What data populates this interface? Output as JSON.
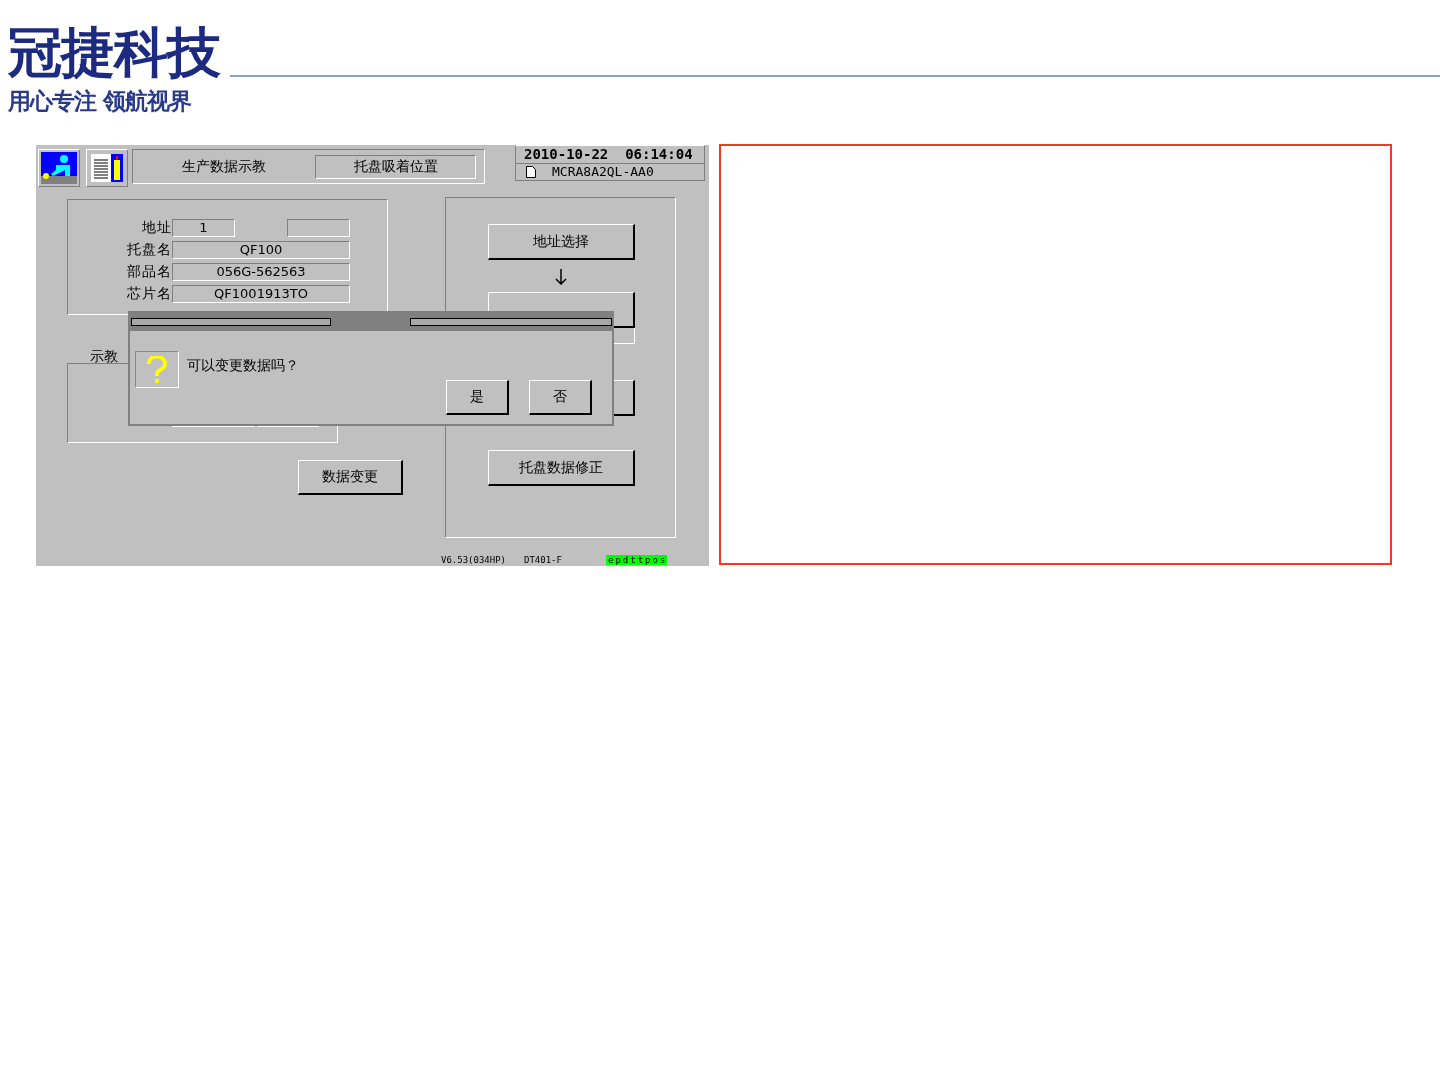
{
  "logo": {
    "name": "冠捷科技",
    "slogan": "用心专注 领航视界"
  },
  "screen": {
    "title": "生产数据示教",
    "subtitle": "托盘吸着位置",
    "datetime": "2010-10-22  06:14:04",
    "file": "MCRA8A2QL-AA0",
    "fields": [
      {
        "label": "地址",
        "value": "1",
        "extra_field": true
      },
      {
        "label": "托盘名",
        "value": "QF100",
        "extra_field": false
      },
      {
        "label": "部品名",
        "value": "056G-562563",
        "extra_field": false
      },
      {
        "label": "芯片名",
        "value": "QF1001913TO",
        "extra_field": false
      }
    ],
    "teach_label": "示教",
    "change_button": "数据变更",
    "right_buttons": [
      "地址选择",
      "托盘数据修正"
    ],
    "status": {
      "version": "V6.53(034HP)",
      "model": "DT401-F",
      "code": "epdttpos"
    },
    "dialog": {
      "message": "可以变更数据吗？",
      "buttons": [
        "是",
        "否"
      ]
    }
  }
}
